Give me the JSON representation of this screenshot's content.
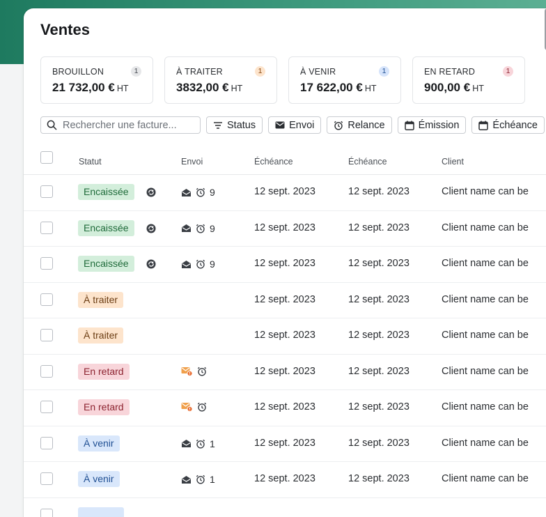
{
  "page_title": "Ventes",
  "colors": {
    "encaissee_bg": "#d3eedb",
    "encaissee_fg": "#1f6b3a",
    "traiter_bg": "#fde4cc",
    "traiter_fg": "#6b3d13",
    "retard_bg": "#f8d5da",
    "retard_fg": "#8c2330",
    "venir_bg": "#d9e7fb",
    "venir_fg": "#1f4f93"
  },
  "cards": [
    {
      "label": "BROUILLON",
      "count": "1",
      "amount": "21 732,00 €",
      "unit": "HT"
    },
    {
      "label": "À TRAITER",
      "count": "1",
      "amount": "3832,00 €",
      "unit": "HT"
    },
    {
      "label": "À VENIR",
      "count": "1",
      "amount": "17 622,00 €",
      "unit": "HT"
    },
    {
      "label": "EN RETARD",
      "count": "1",
      "amount": "900,00 €",
      "unit": "HT"
    }
  ],
  "search": {
    "placeholder": "Rechercher une facture..."
  },
  "filters": {
    "status": "Status",
    "envoi": "Envoi",
    "relance": "Relance",
    "emission": "Émission",
    "echeance": "Échéance"
  },
  "table": {
    "headers": {
      "statut": "Statut",
      "envoi": "Envoi",
      "echeance1": "Échéance",
      "echeance2": "Échéance",
      "client": "Client"
    },
    "rows": [
      {
        "status": "Encaissée",
        "type": "encaissee",
        "sync": true,
        "envoi": "open",
        "relance": "9",
        "date1": "12 sept. 2023",
        "date2": "12 sept. 2023",
        "client": "Client name can be"
      },
      {
        "status": "Encaissée",
        "type": "encaissee",
        "sync": true,
        "envoi": "open",
        "relance": "9",
        "date1": "12 sept. 2023",
        "date2": "12 sept. 2023",
        "client": "Client name can be"
      },
      {
        "status": "Encaissée",
        "type": "encaissee",
        "sync": true,
        "envoi": "open",
        "relance": "9",
        "date1": "12 sept. 2023",
        "date2": "12 sept. 2023",
        "client": "Client name can be"
      },
      {
        "status": "À traiter",
        "type": "traiter",
        "sync": false,
        "envoi": "none",
        "relance": "",
        "date1": "12 sept. 2023",
        "date2": "12 sept. 2023",
        "client": "Client name can be"
      },
      {
        "status": "À traiter",
        "type": "traiter",
        "sync": false,
        "envoi": "none",
        "relance": "",
        "date1": "12 sept. 2023",
        "date2": "12 sept. 2023",
        "client": "Client name can be"
      },
      {
        "status": "En retard",
        "type": "retard",
        "sync": false,
        "envoi": "alert",
        "relance": "",
        "date1": "12 sept. 2023",
        "date2": "12 sept. 2023",
        "client": "Client name can be"
      },
      {
        "status": "En retard",
        "type": "retard",
        "sync": false,
        "envoi": "alert",
        "relance": "",
        "date1": "12 sept. 2023",
        "date2": "12 sept. 2023",
        "client": "Client name can be"
      },
      {
        "status": "À venir",
        "type": "venir",
        "sync": false,
        "envoi": "open",
        "relance": "1",
        "date1": "12 sept. 2023",
        "date2": "12 sept. 2023",
        "client": "Client name can be"
      },
      {
        "status": "À venir",
        "type": "venir",
        "sync": false,
        "envoi": "open",
        "relance": "1",
        "date1": "12 sept. 2023",
        "date2": "12 sept. 2023",
        "client": "Client name can be"
      },
      {
        "status": "",
        "type": "venir",
        "sync": false,
        "envoi": "none",
        "relance": "",
        "date1": "",
        "date2": "",
        "client": ""
      }
    ]
  }
}
